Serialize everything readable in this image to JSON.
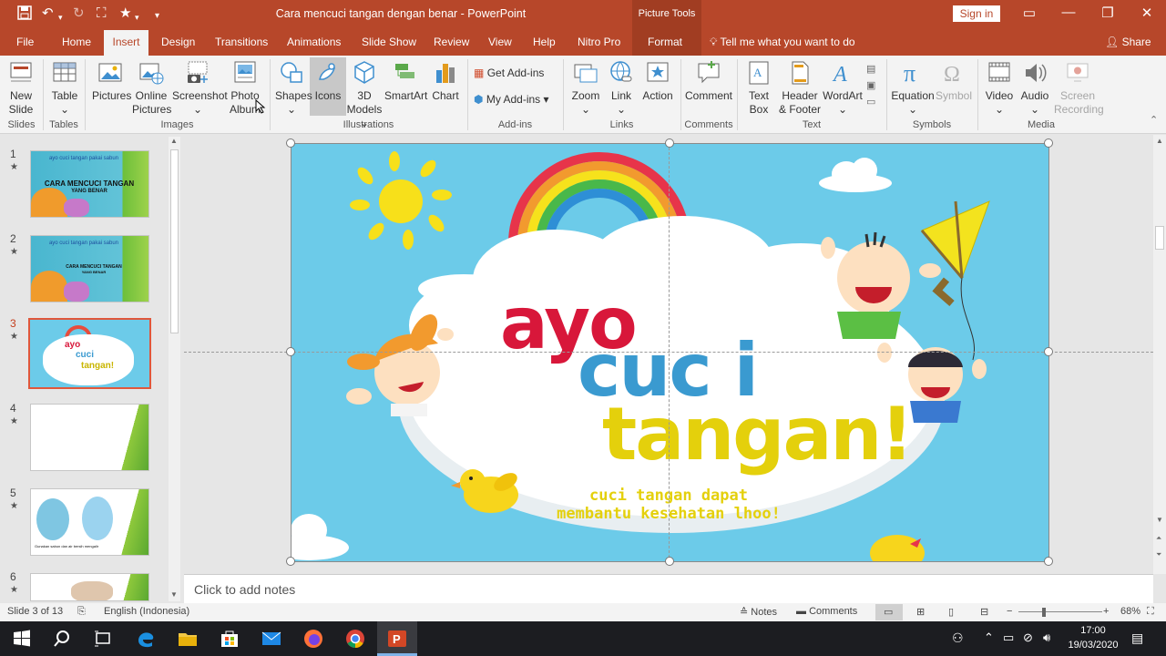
{
  "titlebar": {
    "doc_title": "Cara mencuci tangan dengan benar - PowerPoint",
    "context_header": "Picture Tools",
    "signin_label": "Sign in"
  },
  "tabs": [
    {
      "label": "File"
    },
    {
      "label": "Home"
    },
    {
      "label": "Insert"
    },
    {
      "label": "Design"
    },
    {
      "label": "Transitions"
    },
    {
      "label": "Animations"
    },
    {
      "label": "Slide Show"
    },
    {
      "label": "Review"
    },
    {
      "label": "View"
    },
    {
      "label": "Help"
    },
    {
      "label": "Nitro Pro"
    },
    {
      "label": "Format"
    }
  ],
  "tellme": "Tell me what you want to do",
  "share": "Share",
  "ribbon": {
    "buttons": {
      "new_slide": "New Slide",
      "table": "Table",
      "pictures": "Pictures",
      "online_pictures": "Online Pictures",
      "screenshot": "Screenshot",
      "photo_album": "Photo Album",
      "shapes": "Shapes",
      "icons": "Icons",
      "models_3d": "3D Models",
      "smartart": "SmartArt",
      "chart": "Chart",
      "get_addins": "Get Add-ins",
      "my_addins": "My Add-ins",
      "zoom": "Zoom",
      "link": "Link",
      "action": "Action",
      "comment": "Comment",
      "text_box": "Text Box",
      "header_footer": "Header & Footer",
      "wordart": "WordArt",
      "equation": "Equation",
      "symbol": "Symbol",
      "video": "Video",
      "audio": "Audio",
      "screen_recording": "Screen Recording"
    },
    "groups": {
      "slides": "Slides",
      "tables": "Tables",
      "images": "Images",
      "illustrations": "Illustrations",
      "addins": "Add-ins",
      "links": "Links",
      "comments": "Comments",
      "text": "Text",
      "symbols": "Symbols",
      "media": "Media"
    }
  },
  "thumbnails": [
    {
      "number": "1",
      "star": "★",
      "line1": "ayo cuci tangan pakai sabun",
      "line2": "CARA MENCUCI TANGAN",
      "line3": "YANG BENAR"
    },
    {
      "number": "2",
      "star": "★",
      "line1": "ayo cuci tangan pakai sabun",
      "line2": "CARA MENCUCI TANGAN",
      "line3": "YANG BENAR"
    },
    {
      "number": "3",
      "star": "★",
      "line1": "ayo",
      "line2": "cuci",
      "line3": "tangan!"
    },
    {
      "number": "4",
      "star": "★"
    },
    {
      "number": "5",
      "star": "★",
      "caption": "Gunakan sabun dan air bersih mengalir"
    },
    {
      "number": "6",
      "star": "★"
    }
  ],
  "slide": {
    "word1": "ayo",
    "word2": "cuc i",
    "word3": "tangan!",
    "sub1": "cuci tangan dapat",
    "sub2": "membantu kesehatan lhoo!"
  },
  "notes_placeholder": "Click to add notes",
  "status": {
    "slide_info": "Slide 3 of 13",
    "language": "English (Indonesia)",
    "notes": "Notes",
    "comments": "Comments",
    "zoom": "68%"
  },
  "taskbar": {
    "time": "17:00",
    "date": "19/03/2020"
  },
  "colors": {
    "accent": "#b7472a",
    "slide_sky": "#6ccbe9",
    "word_red": "#d8173a",
    "word_blue": "#3a9ad0",
    "word_yellow": "#e4d00c"
  }
}
